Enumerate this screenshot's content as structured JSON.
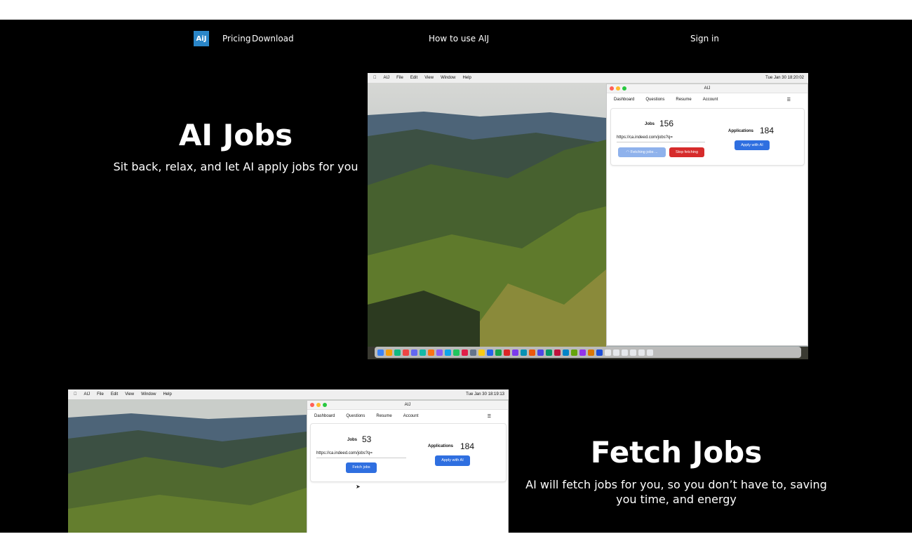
{
  "nav": {
    "logo": "AiJ",
    "pricing": "Pricing",
    "download": "Download",
    "how_to": "How to use AIJ",
    "sign_in": "Sign in"
  },
  "hero1": {
    "title": "AI Jobs",
    "subtitle": "Sit back, relax, and let AI apply jobs for you"
  },
  "hero2": {
    "title": "Fetch Jobs",
    "subtitle": "AI will fetch jobs for you, so you don’t have to, saving you time, and energy"
  },
  "shot1": {
    "menubar": [
      "AIJ",
      "File",
      "Edit",
      "View",
      "Window",
      "Help"
    ],
    "clock": "Tue Jan 30  18:20:02",
    "window_title": "AIJ",
    "tabs": [
      "Dashboard",
      "Questions",
      "Resume",
      "Account"
    ],
    "jobs_label": "Jobs",
    "jobs_count": "156",
    "url_value": "https://ca.indeed.com/jobs?q=",
    "fetching_label": "Fetching jobs ...",
    "stop_label": "Stop fetching",
    "applications_label": "Applications",
    "applications_count": "184",
    "apply_label": "Apply with AI"
  },
  "shot2": {
    "menubar": [
      "AIJ",
      "File",
      "Edit",
      "View",
      "Window",
      "Help"
    ],
    "clock": "Tue Jan 30  18:19:13",
    "window_title": "AIJ",
    "tabs": [
      "Dashboard",
      "Questions",
      "Resume",
      "Account"
    ],
    "jobs_label": "Jobs",
    "jobs_count": "53",
    "url_value": "https://ca.indeed.com/jobs?q=",
    "fetch_label": "Fetch jobs",
    "applications_label": "Applications",
    "applications_count": "184",
    "apply_label": "Apply with AI"
  },
  "colors": {
    "accent_blue": "#2f6fe0",
    "light_blue": "#8fb2ec",
    "stop_red": "#d62b2b",
    "logo_blue": "#2a86c8"
  },
  "icons": [
    "apple-icon",
    "hamburger-menu-icon",
    "spinner-icon",
    "cursor-icon",
    "wifi-icon",
    "battery-icon"
  ]
}
